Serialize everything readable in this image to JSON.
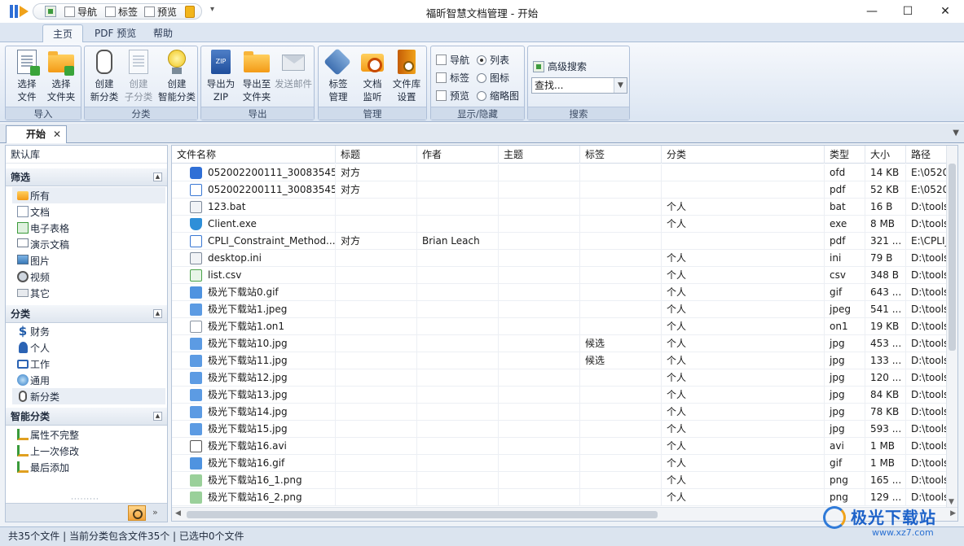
{
  "title_bar": {
    "app_title": "福昕智慧文档管理 - 开始",
    "quick_access": [
      {
        "label": "导航",
        "checked": false
      },
      {
        "label": "标签",
        "checked": false
      },
      {
        "label": "预览",
        "checked": false
      }
    ],
    "quick_access_dropdown": "▾",
    "minimize": "—",
    "maximize": "☐",
    "close": "✕"
  },
  "ribbon_tabs": [
    {
      "label": "主页",
      "active": true
    },
    {
      "label": "PDF 预览",
      "active": false
    },
    {
      "label": "帮助",
      "active": false
    }
  ],
  "ribbon": {
    "import": {
      "label": "导入",
      "buttons": [
        {
          "line1": "选择",
          "line2": "文件",
          "icon": "select-file-icon"
        },
        {
          "line1": "选择",
          "line2": "文件夹",
          "icon": "select-folder-icon"
        }
      ]
    },
    "category": {
      "label": "分类",
      "buttons": [
        {
          "line1": "创建",
          "line2": "新分类",
          "icon": "new-category-icon"
        },
        {
          "line1": "创建",
          "line2": "子分类",
          "icon": "sub-category-icon",
          "disabled": true
        },
        {
          "line1": "创建",
          "line2": "智能分类",
          "icon": "smart-category-icon"
        }
      ]
    },
    "export": {
      "label": "导出",
      "buttons": [
        {
          "line1": "导出为",
          "line2": "ZIP",
          "icon": "zip-icon"
        },
        {
          "line1": "导出至",
          "line2": "文件夹",
          "icon": "export-folder-icon"
        },
        {
          "line1": "发送邮件",
          "line2": "",
          "icon": "mail-icon",
          "disabled": true
        }
      ]
    },
    "manage": {
      "label": "管理",
      "buttons": [
        {
          "line1": "标签",
          "line2": "管理",
          "icon": "tag-icon"
        },
        {
          "line1": "文档",
          "line2": "监听",
          "icon": "monitor-icon"
        },
        {
          "line1": "文件库",
          "line2": "设置",
          "icon": "library-settings-icon"
        }
      ]
    },
    "display": {
      "label": "显示/隐藏",
      "checks": [
        {
          "label": "导航",
          "checked": false
        },
        {
          "label": "标签",
          "checked": false
        },
        {
          "label": "预览",
          "checked": false
        }
      ],
      "radios": [
        {
          "label": "列表",
          "selected": true
        },
        {
          "label": "图标",
          "selected": false
        },
        {
          "label": "缩略图",
          "selected": false
        }
      ]
    },
    "search": {
      "label": "搜索",
      "advanced_label": "高级搜索",
      "combo_value": "查找..."
    }
  },
  "doc_tabs": [
    {
      "label": "开始",
      "close": "✕"
    }
  ],
  "left_panel": {
    "library_label": "默认库",
    "filter": {
      "header": "筛选",
      "items": [
        {
          "label": "所有",
          "selected": true,
          "icon": "folder-icon"
        },
        {
          "label": "文档",
          "icon": "document-icon"
        },
        {
          "label": "电子表格",
          "icon": "spreadsheet-icon"
        },
        {
          "label": "演示文稿",
          "icon": "presentation-icon"
        },
        {
          "label": "图片",
          "icon": "picture-icon"
        },
        {
          "label": "视频",
          "icon": "video-icon"
        },
        {
          "label": "其它",
          "icon": "other-icon"
        }
      ]
    },
    "category": {
      "header": "分类",
      "items": [
        {
          "label": "财务",
          "icon": "dollar-icon"
        },
        {
          "label": "个人",
          "icon": "person-icon"
        },
        {
          "label": "工作",
          "icon": "briefcase-icon"
        },
        {
          "label": "通用",
          "icon": "globe-icon"
        },
        {
          "label": "新分类",
          "selected": true,
          "icon": "clip-icon"
        }
      ]
    },
    "smart": {
      "header": "智能分类",
      "items": [
        {
          "label": "属性不完整",
          "icon": "smart-filter-icon"
        },
        {
          "label": "上一次修改",
          "icon": "smart-filter-icon"
        },
        {
          "label": "最后添加",
          "icon": "smart-filter-icon"
        }
      ]
    },
    "more": "»"
  },
  "file_table": {
    "columns": [
      "文件名称",
      "标题",
      "作者",
      "主题",
      "标签",
      "分类",
      "类型",
      "大小",
      "路径"
    ],
    "rows": [
      {
        "name": "052002200111_30083545...",
        "title": "对方",
        "author": "",
        "subject": "",
        "tag": "",
        "category": "",
        "type": "ofd",
        "size": "14 KB",
        "path": "E:\\0520",
        "icon": "ofd-file-icon",
        "cls": "f-ofd"
      },
      {
        "name": "052002200111_30083545...",
        "title": "对方",
        "author": "",
        "subject": "",
        "tag": "",
        "category": "",
        "type": "pdf",
        "size": "52 KB",
        "path": "E:\\0520",
        "icon": "pdf-file-icon",
        "cls": "f-pdf"
      },
      {
        "name": "123.bat",
        "title": "",
        "author": "",
        "subject": "",
        "tag": "",
        "category": "个人",
        "type": "bat",
        "size": "16 B",
        "path": "D:\\tools",
        "icon": "bat-file-icon",
        "cls": "f-bat"
      },
      {
        "name": "Client.exe",
        "title": "",
        "author": "",
        "subject": "",
        "tag": "",
        "category": "个人",
        "type": "exe",
        "size": "8 MB",
        "path": "D:\\tools",
        "icon": "exe-file-icon",
        "cls": "f-exe"
      },
      {
        "name": "CPLI_Constraint_Method....",
        "title": "对方",
        "author": "Brian Leach",
        "subject": "",
        "tag": "",
        "category": "",
        "type": "pdf",
        "size": "321 ...",
        "path": "E:\\CPLI_",
        "icon": "pdf-file-icon",
        "cls": "f-pdf"
      },
      {
        "name": "desktop.ini",
        "title": "",
        "author": "",
        "subject": "",
        "tag": "",
        "category": "个人",
        "type": "ini",
        "size": "79 B",
        "path": "D:\\tools",
        "icon": "ini-file-icon",
        "cls": "f-ini"
      },
      {
        "name": "list.csv",
        "title": "",
        "author": "",
        "subject": "",
        "tag": "",
        "category": "个人",
        "type": "csv",
        "size": "348 B",
        "path": "D:\\tools",
        "icon": "csv-file-icon",
        "cls": "f-csv"
      },
      {
        "name": "极光下载站0.gif",
        "title": "",
        "author": "",
        "subject": "",
        "tag": "",
        "category": "个人",
        "type": "gif",
        "size": "643 ...",
        "path": "D:\\tools",
        "icon": "gif-file-icon",
        "cls": "f-gif"
      },
      {
        "name": "极光下载站1.jpeg",
        "title": "",
        "author": "",
        "subject": "",
        "tag": "",
        "category": "个人",
        "type": "jpeg",
        "size": "541 ...",
        "path": "D:\\tools",
        "icon": "jpg-file-icon",
        "cls": "f-jpg"
      },
      {
        "name": "极光下载站1.on1",
        "title": "",
        "author": "",
        "subject": "",
        "tag": "",
        "category": "个人",
        "type": "on1",
        "size": "19 KB",
        "path": "D:\\tools",
        "icon": "blank-file-icon",
        "cls": "f-blank"
      },
      {
        "name": "极光下载站10.jpg",
        "title": "",
        "author": "",
        "subject": "",
        "tag": "候选",
        "category": "个人",
        "type": "jpg",
        "size": "453 ...",
        "path": "D:\\tools",
        "icon": "jpg-file-icon",
        "cls": "f-jpg"
      },
      {
        "name": "极光下载站11.jpg",
        "title": "",
        "author": "",
        "subject": "",
        "tag": "候选",
        "category": "个人",
        "type": "jpg",
        "size": "133 ...",
        "path": "D:\\tools",
        "icon": "jpg-file-icon",
        "cls": "f-jpg"
      },
      {
        "name": "极光下载站12.jpg",
        "title": "",
        "author": "",
        "subject": "",
        "tag": "",
        "category": "个人",
        "type": "jpg",
        "size": "120 ...",
        "path": "D:\\tools",
        "icon": "jpg-file-icon",
        "cls": "f-jpg"
      },
      {
        "name": "极光下载站13.jpg",
        "title": "",
        "author": "",
        "subject": "",
        "tag": "",
        "category": "个人",
        "type": "jpg",
        "size": "84 KB",
        "path": "D:\\tools",
        "icon": "jpg-file-icon",
        "cls": "f-jpg"
      },
      {
        "name": "极光下载站14.jpg",
        "title": "",
        "author": "",
        "subject": "",
        "tag": "",
        "category": "个人",
        "type": "jpg",
        "size": "78 KB",
        "path": "D:\\tools",
        "icon": "jpg-file-icon",
        "cls": "f-jpg"
      },
      {
        "name": "极光下载站15.jpg",
        "title": "",
        "author": "",
        "subject": "",
        "tag": "",
        "category": "个人",
        "type": "jpg",
        "size": "593 ...",
        "path": "D:\\tools",
        "icon": "jpg-file-icon",
        "cls": "f-jpg"
      },
      {
        "name": "极光下载站16.avi",
        "title": "",
        "author": "",
        "subject": "",
        "tag": "",
        "category": "个人",
        "type": "avi",
        "size": "1 MB",
        "path": "D:\\tools",
        "icon": "avi-file-icon",
        "cls": "f-avi"
      },
      {
        "name": "极光下载站16.gif",
        "title": "",
        "author": "",
        "subject": "",
        "tag": "",
        "category": "个人",
        "type": "gif",
        "size": "1 MB",
        "path": "D:\\tools",
        "icon": "gif-file-icon",
        "cls": "f-gif"
      },
      {
        "name": "极光下载站16_1.png",
        "title": "",
        "author": "",
        "subject": "",
        "tag": "",
        "category": "个人",
        "type": "png",
        "size": "165 ...",
        "path": "D:\\tools",
        "icon": "png-file-icon",
        "cls": "f-png"
      },
      {
        "name": "极光下载站16_2.png",
        "title": "",
        "author": "",
        "subject": "",
        "tag": "",
        "category": "个人",
        "type": "png",
        "size": "129 ...",
        "path": "D:\\tools",
        "icon": "png-file-icon",
        "cls": "f-png"
      }
    ]
  },
  "status": "共35个文件 | 当前分类包含文件35个 | 已选中0个文件",
  "watermark": {
    "text": "极光下载站",
    "url": "www.xz7.com"
  }
}
